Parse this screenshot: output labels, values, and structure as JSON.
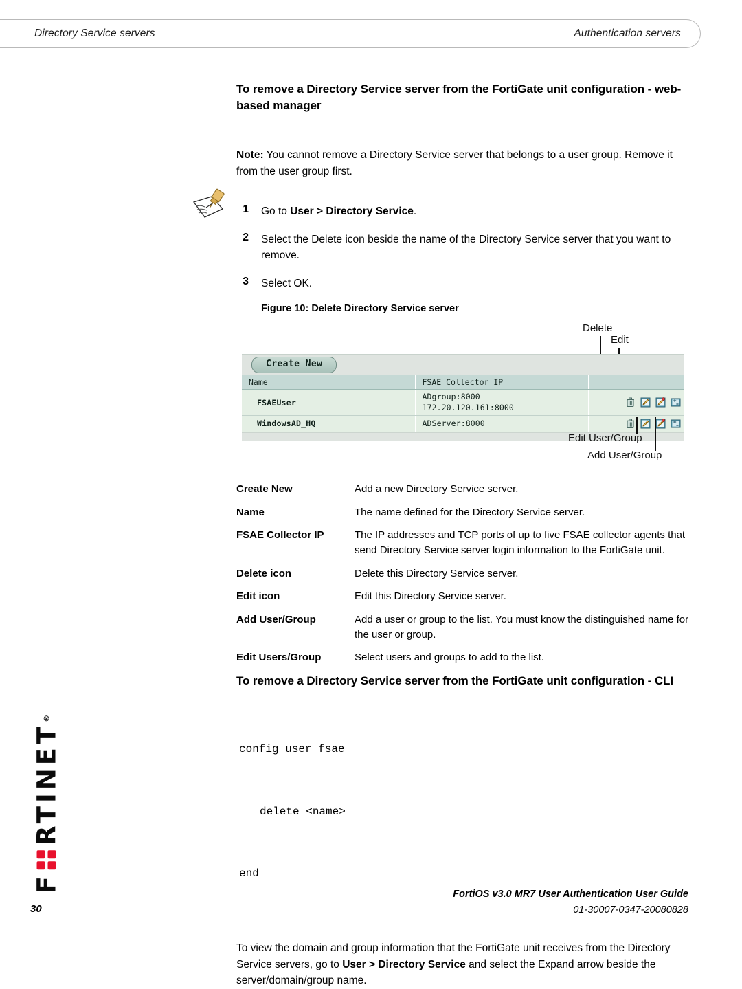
{
  "header": {
    "left": "Directory Service servers",
    "right": "Authentication servers"
  },
  "section": {
    "heading": "To remove a Directory Service server from the FortiGate unit configuration - web-based manager"
  },
  "note": {
    "label": "Note:",
    "text": " You cannot remove a Directory Service server that belongs to a user group. Remove it from the user group first.",
    "icon": "note-pen-paper-icon"
  },
  "steps": [
    {
      "num": "1",
      "text_before": "Go to ",
      "bold": "User > Directory Service",
      "text_after": "."
    },
    {
      "num": "2",
      "text_before": "Select the Delete icon beside the name of the Directory Service server that you want to remove.",
      "bold": "",
      "text_after": ""
    },
    {
      "num": "3",
      "text_before": "Select OK.",
      "bold": "",
      "text_after": ""
    }
  ],
  "figure": {
    "caption": "Figure 10: Delete Directory Service server",
    "callouts": {
      "delete": "Delete",
      "edit": "Edit",
      "edit_user_group": "Edit User/Group",
      "add_user_group": "Add User/Group"
    },
    "gui": {
      "create_new_label": "Create New",
      "columns": [
        "Name",
        "FSAE Collector IP",
        ""
      ],
      "rows": [
        {
          "name": "FSAEUser",
          "ip": "ADgroup:8000\n172.20.120.161:8000"
        },
        {
          "name": "WindowsAD_HQ",
          "ip": "ADServer:8000"
        }
      ],
      "row_icons": [
        "delete-icon",
        "edit-icon",
        "edit-user-group-icon",
        "add-user-group-icon"
      ]
    }
  },
  "definitions": [
    {
      "term": "Create New",
      "desc": "Add a new Directory Service server."
    },
    {
      "term": "Name",
      "desc": "The name defined for the Directory Service server."
    },
    {
      "term": "FSAE Collector IP",
      "desc": "The IP addresses and TCP ports of up to five FSAE collector agents that send Directory Service server login information to the FortiGate unit."
    },
    {
      "term": "Delete icon",
      "desc": "Delete this Directory Service server."
    },
    {
      "term": "Edit icon",
      "desc": "Edit this Directory Service server."
    },
    {
      "term": "Add User/Group",
      "desc": "Add a user or group to the list. You must know the distinguished name for the user or group."
    },
    {
      "term": "Edit Users/Group",
      "desc": "Select users and groups to add to the list."
    }
  ],
  "cli": {
    "heading": "To remove a Directory Service server from the FortiGate unit configuration - CLI",
    "lines": [
      "config user fsae",
      "delete <name>",
      "end"
    ]
  },
  "trailing": {
    "text_before": "To view the domain and group information that the FortiGate unit receives from the Directory Service servers, go to ",
    "bold": "User > Directory Service",
    "text_after": " and select the Expand arrow beside the server/domain/group name."
  },
  "logo": {
    "text_a": "F",
    "text_b": "RTINET",
    "registered": "®",
    "accent_color": "#e8112d"
  },
  "footer": {
    "page_number": "30",
    "guide_title": "FortiOS v3.0 MR7 User Authentication User Guide",
    "doc_number": "01-30007-0347-20080828"
  }
}
